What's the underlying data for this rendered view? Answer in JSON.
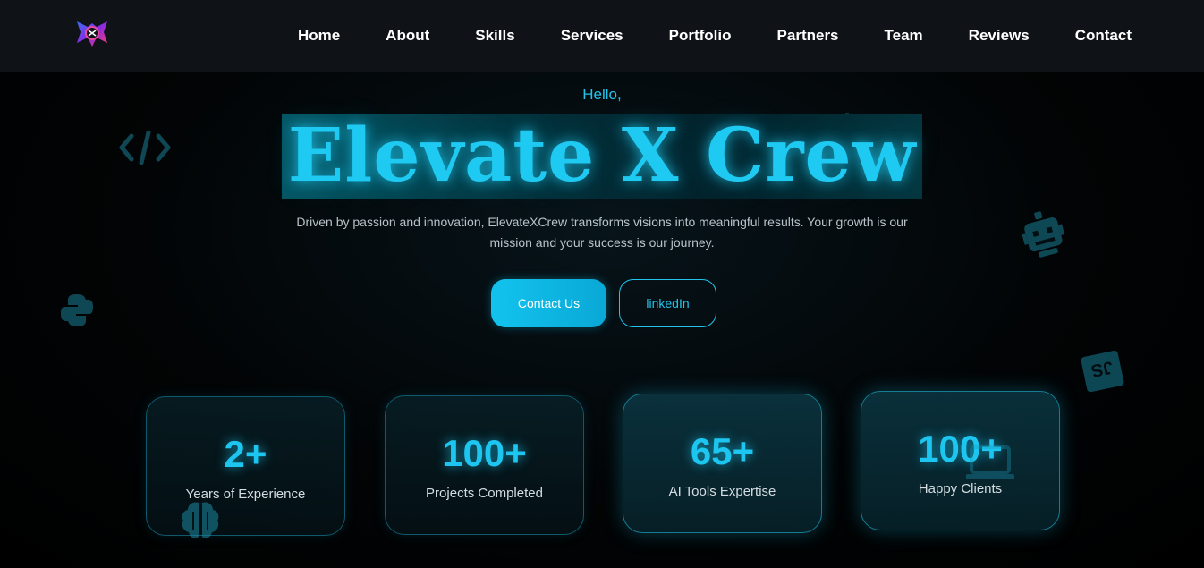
{
  "nav": {
    "items": [
      {
        "label": "Home"
      },
      {
        "label": "About"
      },
      {
        "label": "Skills"
      },
      {
        "label": "Services"
      },
      {
        "label": "Portfolio"
      },
      {
        "label": "Partners"
      },
      {
        "label": "Team"
      },
      {
        "label": "Reviews"
      },
      {
        "label": "Contact"
      }
    ]
  },
  "hero": {
    "greeting": "Hello,",
    "title": "Elevate X Crew",
    "subtitle_line1": "Driven by passion and innovation, ElevateXCrew transforms visions into meaningful results. Your growth is our",
    "subtitle_line2": "mission and your success is our journey.",
    "primary_button": "Contact Us",
    "secondary_button": "linkedIn"
  },
  "stats": [
    {
      "value": "2+",
      "label": "Years of Experience"
    },
    {
      "value": "100+",
      "label": "Projects Completed"
    },
    {
      "value": "65+",
      "label": "AI Tools Expertise"
    },
    {
      "value": "100+",
      "label": "Happy Clients"
    }
  ],
  "colors": {
    "accent": "#1fcaf2",
    "navbar": "#0f1216",
    "background": "#020405"
  },
  "icons": {
    "logo": "elevatex-logo-icon",
    "floating": [
      "code-icon",
      "chart-icon",
      "robot-icon",
      "python-icon",
      "js-icon",
      "brain-icon",
      "laptop-icon"
    ]
  }
}
